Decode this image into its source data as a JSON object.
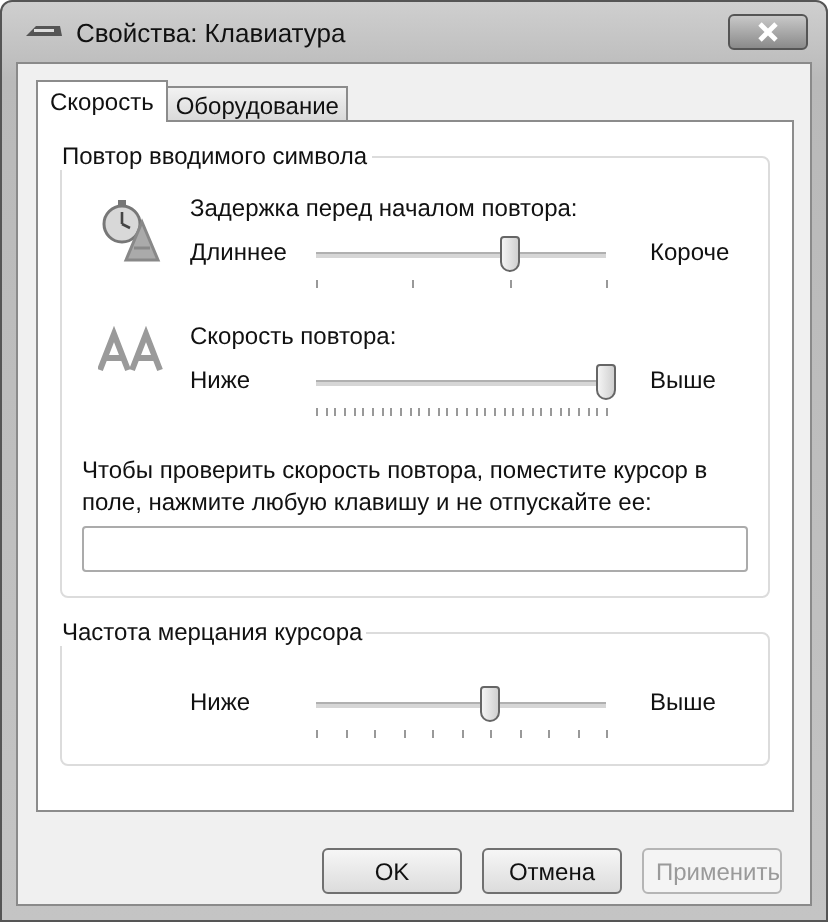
{
  "window": {
    "title": "Свойства: Клавиатура"
  },
  "tabs": [
    {
      "label": "Скорость",
      "selected": true
    },
    {
      "label": "Оборудование",
      "selected": false
    }
  ],
  "repeat_group": {
    "title": "Повтор вводимого символа",
    "settings": [
      {
        "kind": "delay",
        "label": "Задержка перед началом повтора:",
        "min_label": "Длиннее",
        "max_label": "Короче",
        "level": 0.667
      },
      {
        "kind": "rate",
        "label": "Скорость повтора:",
        "min_label": "Ниже",
        "max_label": "Выше",
        "level": 1
      }
    ],
    "test_hint": "Чтобы проверить скорость повтора, поместите курсор в поле, нажмите любую клавишу и не отпускайте ее:"
  },
  "blink_group": {
    "title": "Частота мерцания курсора",
    "min_label": "Ниже",
    "max_label": "Выше",
    "level": 0.6
  },
  "buttons": [
    {
      "label": "OK",
      "disabled": false
    },
    {
      "label": "Отмена",
      "disabled": false
    },
    {
      "label": "Применить",
      "disabled": true
    }
  ]
}
